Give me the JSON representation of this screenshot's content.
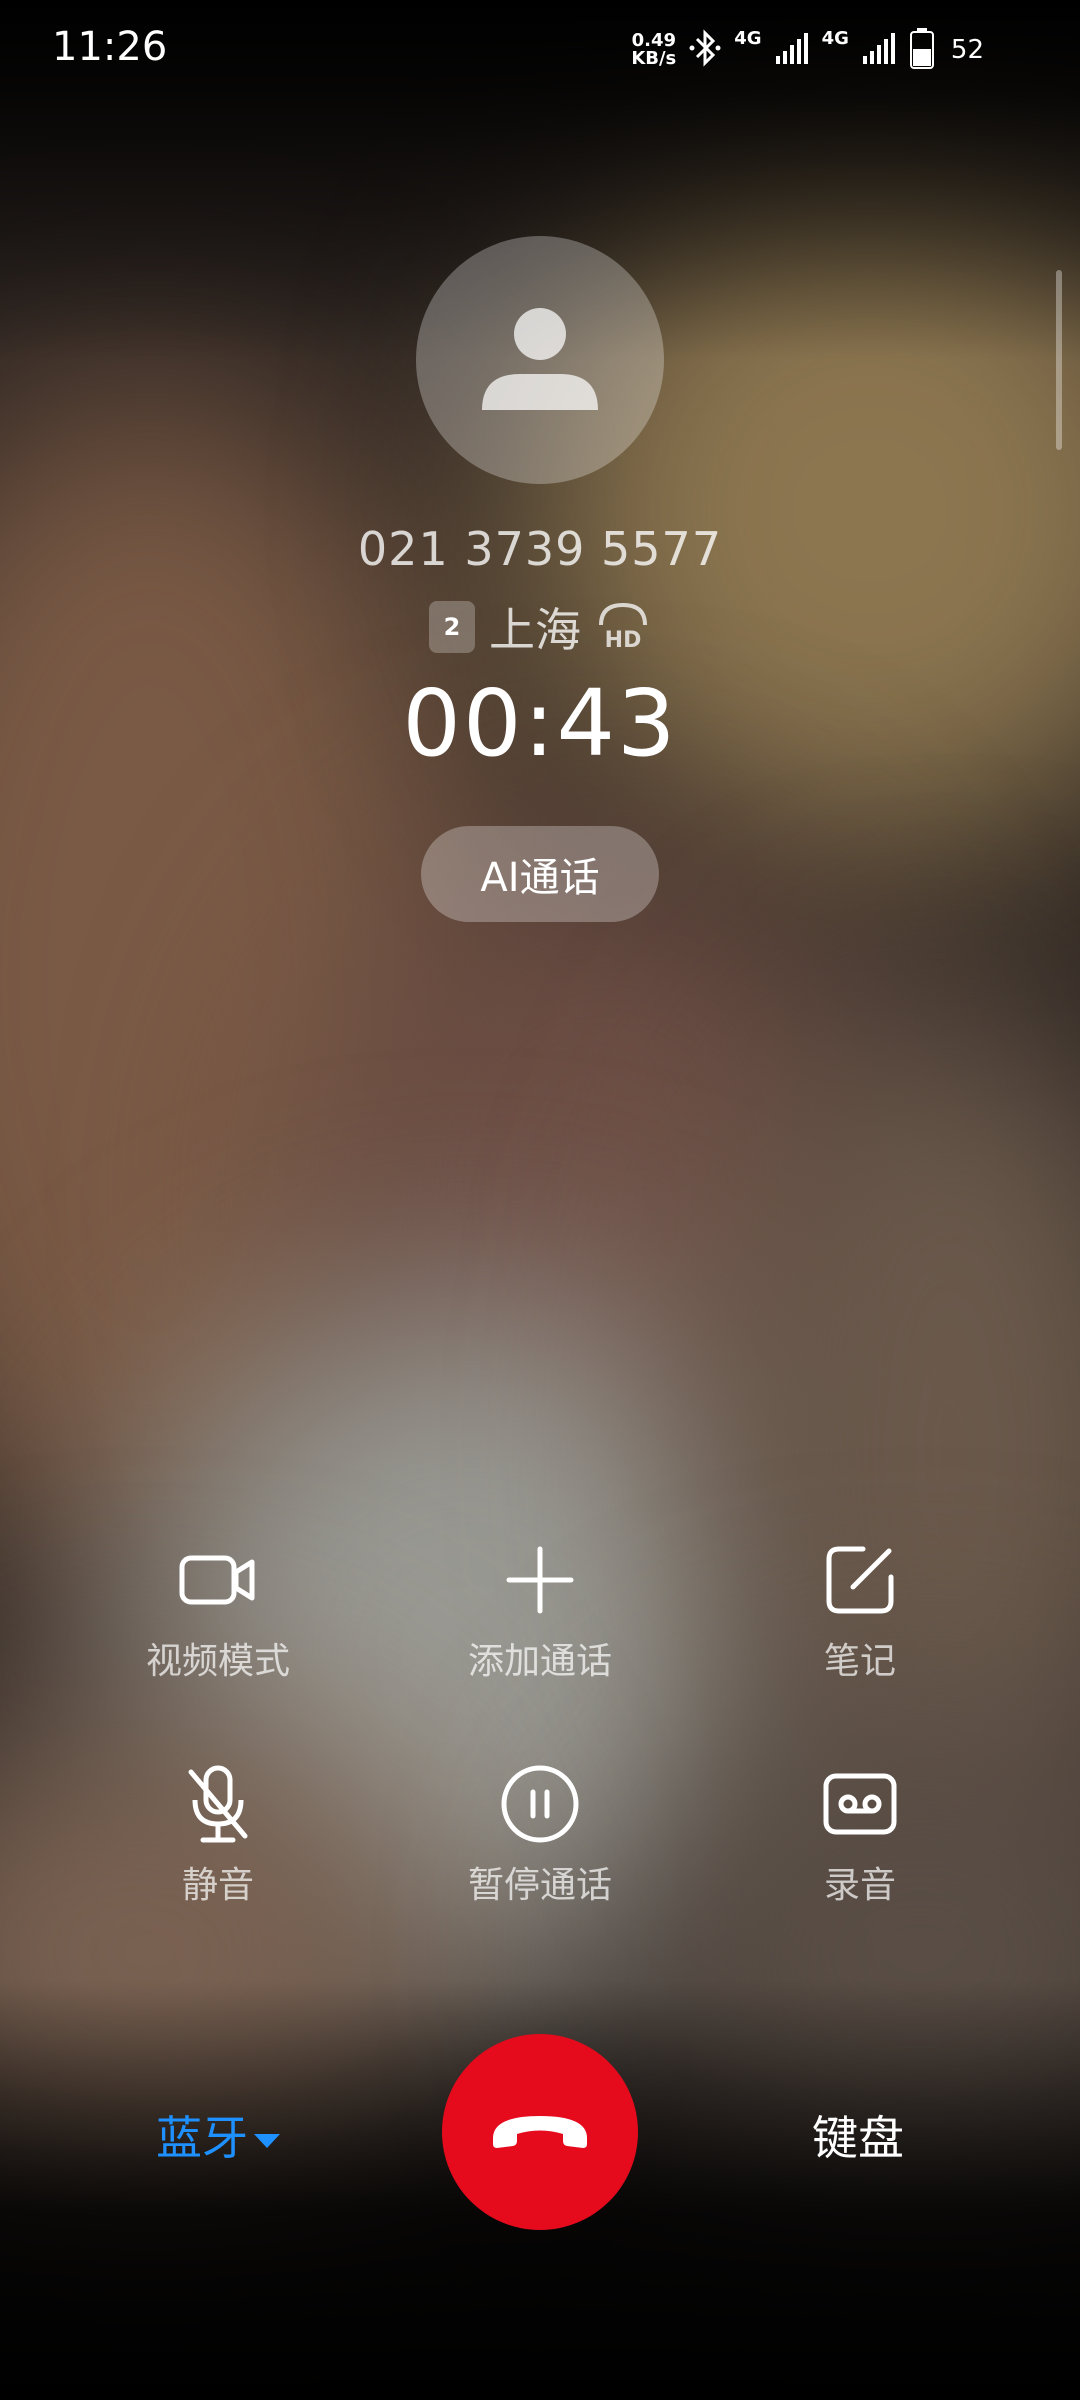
{
  "status_bar": {
    "time": "11:26",
    "net_speed_value": "0.49",
    "net_speed_unit": "KB/s",
    "sim1_label": "4G",
    "sim2_label": "4G",
    "battery_level": "52"
  },
  "call": {
    "number": "021 3739 5577",
    "sim_slot": "2",
    "location": "上海",
    "duration": "00:43",
    "ai_button": "AI通话"
  },
  "controls": {
    "video": "视频模式",
    "add_call": "添加通话",
    "notes": "笔记",
    "mute": "静音",
    "hold": "暂停通话",
    "record": "录音"
  },
  "bottom": {
    "bluetooth": "蓝牙",
    "keypad": "键盘"
  },
  "colors": {
    "hangup": "#e60b1c",
    "bluetooth_accent": "#1e90ff"
  },
  "icons": [
    "person-icon",
    "hd-icon",
    "video-icon",
    "plus-icon",
    "note-icon",
    "mic-off-icon",
    "pause-icon",
    "record-icon",
    "dropdown-icon",
    "end-call-icon",
    "bluetooth-icon",
    "signal-icon",
    "battery-icon"
  ]
}
